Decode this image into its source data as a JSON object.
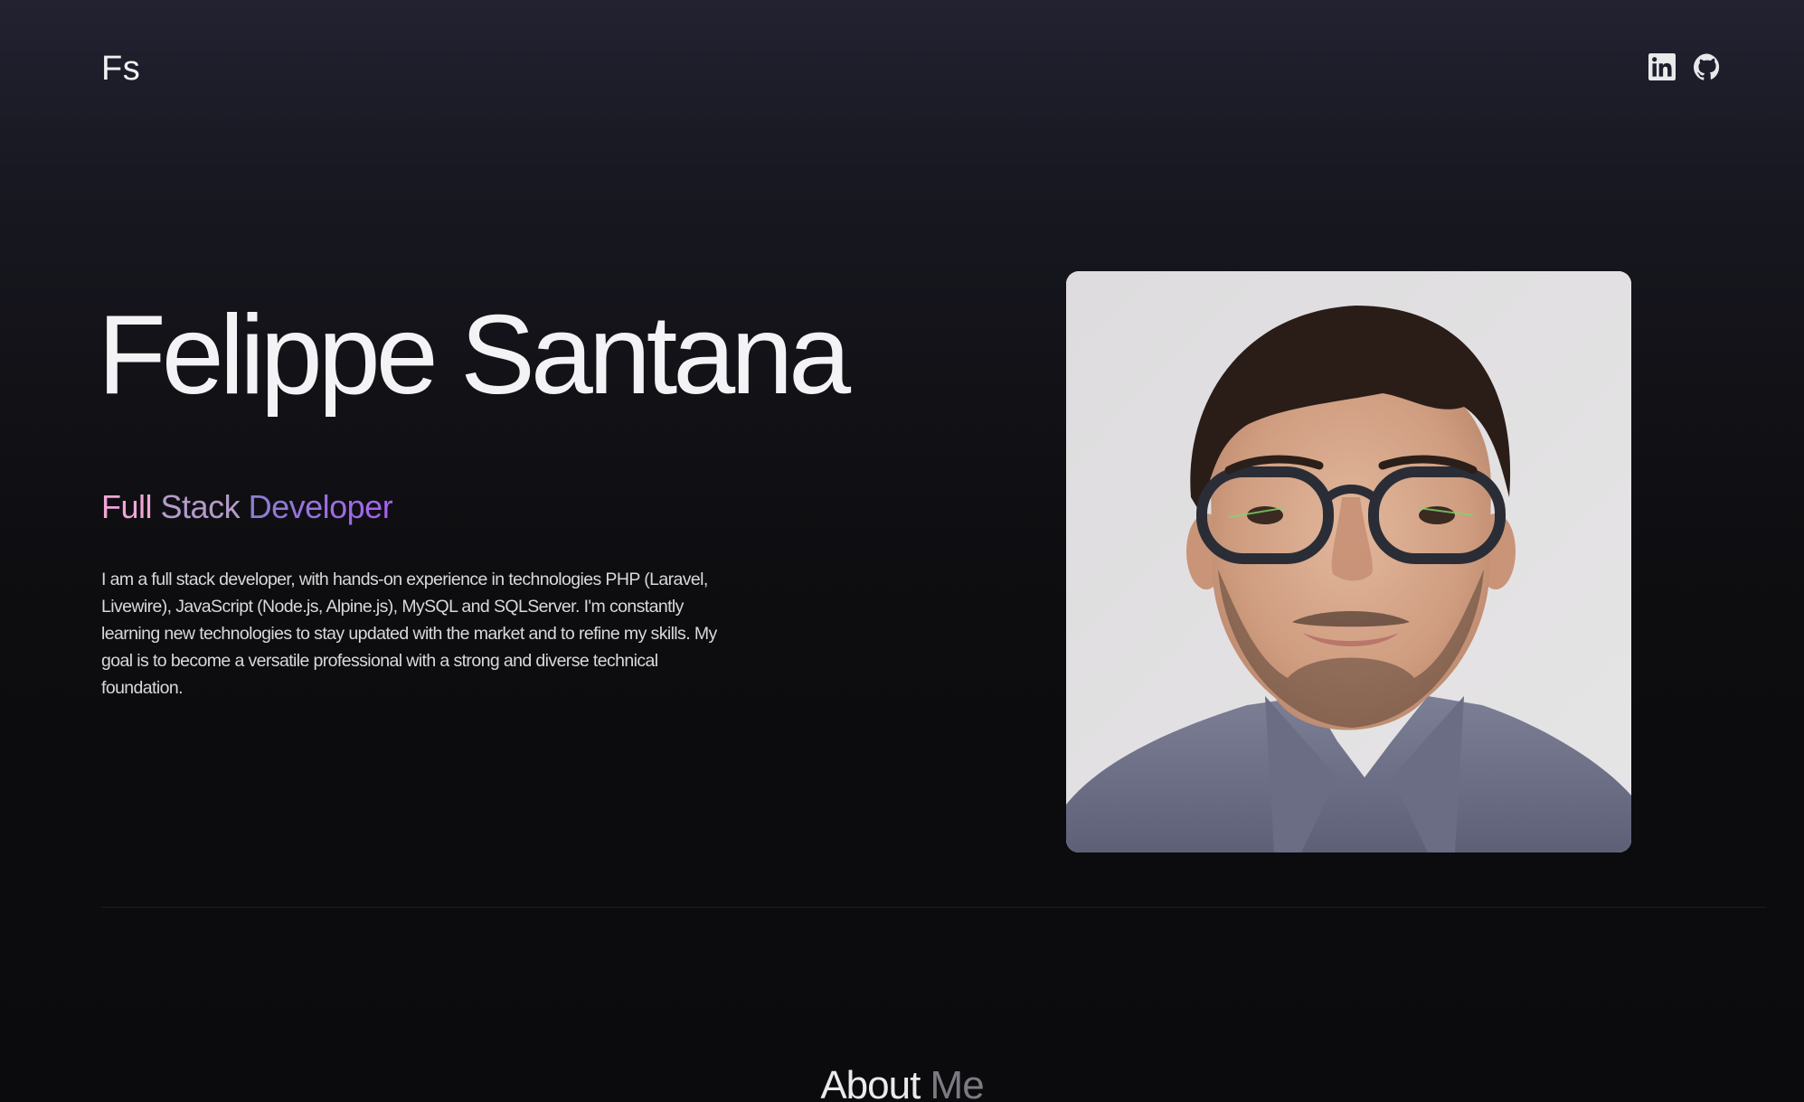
{
  "header": {
    "logo_text": "Fs",
    "social_links": [
      {
        "icon": "linkedin-icon",
        "label": "LinkedIn"
      },
      {
        "icon": "github-icon",
        "label": "GitHub"
      }
    ]
  },
  "hero": {
    "name": "Felippe Santana",
    "role": {
      "word1": "Full",
      "word2": "Stack",
      "word3": "Developer"
    },
    "bio": "I am a full stack developer, with hands-on experience in technologies PHP (Laravel, Livewire), JavaScript (Node.js, Alpine.js), MySQL and SQLServer. I'm constantly learning new technologies to stay updated with the market and to refine my skills. My goal is to become a versatile professional with a strong and diverse technical foundation.",
    "photo_alt": "Felippe Santana"
  },
  "about": {
    "title_word1": "About",
    "title_word2": "Me"
  },
  "colors": {
    "background": "#0b0b0d",
    "role_pink": "#f0a6d6",
    "role_mauve": "#b49bc9",
    "role_purple": "#a661f0",
    "muted_text": "#7b7b82"
  }
}
